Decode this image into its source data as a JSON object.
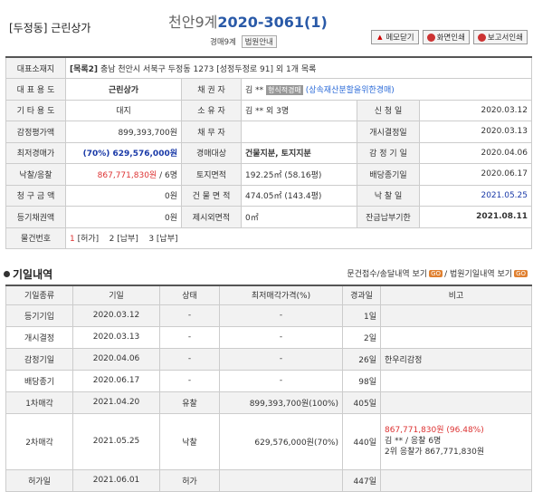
{
  "header": {
    "dong": "[두정동] 근린상가",
    "court": "천안9계",
    "case_no": "2020-3061(1)",
    "sub_court": "경매9계",
    "court_info_label": "법원안내",
    "buttons": {
      "memo": "메모닫기",
      "print": "화면인쇄",
      "report": "보고서인쇄"
    }
  },
  "info": {
    "rep_addr_label": "대표소재지",
    "rep_addr_prefix": "[목록2]",
    "rep_addr": "충남 천안시 서북구 두정동 1273 [성정두정로 91] 외 1개 목록",
    "rows": [
      {
        "l1": "대 표 용 도",
        "v1": "근린상가",
        "l2": "채 권 자",
        "v2": "김 **",
        "v2_badge": "형식적경매",
        "v2_note": "(상속재산분할을위한경매)"
      },
      {
        "l1": "기 타 용 도",
        "v1": "대지",
        "l2": "소 유 자",
        "v2": "김 ** 외 3명",
        "l3": "신 청 일",
        "v3": "2020.03.12"
      },
      {
        "l1": "감정평가액",
        "v1": "899,393,700원",
        "l2": "채 무 자",
        "v2": "",
        "l3": "개시결정일",
        "v3": "2020.03.13"
      },
      {
        "l1": "최저경매가",
        "v1_pct": "(70%)",
        "v1": "629,576,000원",
        "l2": "경매대상",
        "v2": "건물지분, 토지지분",
        "l3": "감 정 기 일",
        "v3": "2020.04.06"
      },
      {
        "l1": "낙찰/응찰",
        "v1": "867,771,830원",
        "v1_suffix": "/ 6명",
        "l2": "토지면적",
        "v2": "192.25㎡ (58.16평)",
        "l3": "배당종기일",
        "v3": "2020.06.17"
      },
      {
        "l1": "청 구 금 액",
        "v1": "0원",
        "l2": "건 물 면 적",
        "v2": "474.05㎡ (143.4평)",
        "l3": "낙 찰 일",
        "v3": "2021.05.25"
      },
      {
        "l1": "등기채권액",
        "v1": "0원",
        "l2": "제시외면적",
        "v2": "0㎡",
        "l3": "잔금납부기한",
        "v3": "2021.08.11"
      }
    ],
    "item_no_label": "물건번호",
    "item_no": {
      "n1": "1",
      "s1": "[허가]",
      "n2": "2",
      "s2": "[납부]",
      "n3": "3",
      "s3": "[납부]"
    }
  },
  "history": {
    "title": "기일내역",
    "link1": "문건접수/송달내역 보기",
    "link2": "/ 법원기일내역 보기",
    "go": "GO",
    "headers": [
      "기일종류",
      "기일",
      "상태",
      "최저매각가격(%)",
      "경과일",
      "비고"
    ],
    "rows": [
      {
        "kind": "등기기입",
        "date": "2020.03.12",
        "status": "-",
        "price": "-",
        "days": "1일",
        "note": ""
      },
      {
        "kind": "개시결정",
        "date": "2020.03.13",
        "status": "-",
        "price": "-",
        "days": "2일",
        "note": ""
      },
      {
        "kind": "감정기일",
        "date": "2020.04.06",
        "status": "-",
        "price": "-",
        "days": "26일",
        "note": "한우리감정"
      },
      {
        "kind": "배당종기",
        "date": "2020.06.17",
        "status": "-",
        "price": "-",
        "days": "98일",
        "note": ""
      },
      {
        "kind": "1차매각",
        "date": "2021.04.20",
        "status": "유찰",
        "price": "899,393,700원(100%)",
        "days": "405일",
        "note": ""
      },
      {
        "kind": "2차매각",
        "date": "2021.05.25",
        "status": "낙찰",
        "price": "629,576,000원(70%)",
        "days": "440일",
        "note1": "867,771,830원 (96.48%)",
        "note2": "김 ** / 응찰 6명",
        "note3": "2위 응찰가 867,771,830원"
      },
      {
        "kind": "허가일",
        "date": "2021.06.01",
        "status": "허가",
        "price": "",
        "days": "447일",
        "note": ""
      }
    ]
  },
  "colors": {
    "caseno": "#2a5aa8",
    "red": "#d33",
    "blue": "#1a3aa8"
  }
}
